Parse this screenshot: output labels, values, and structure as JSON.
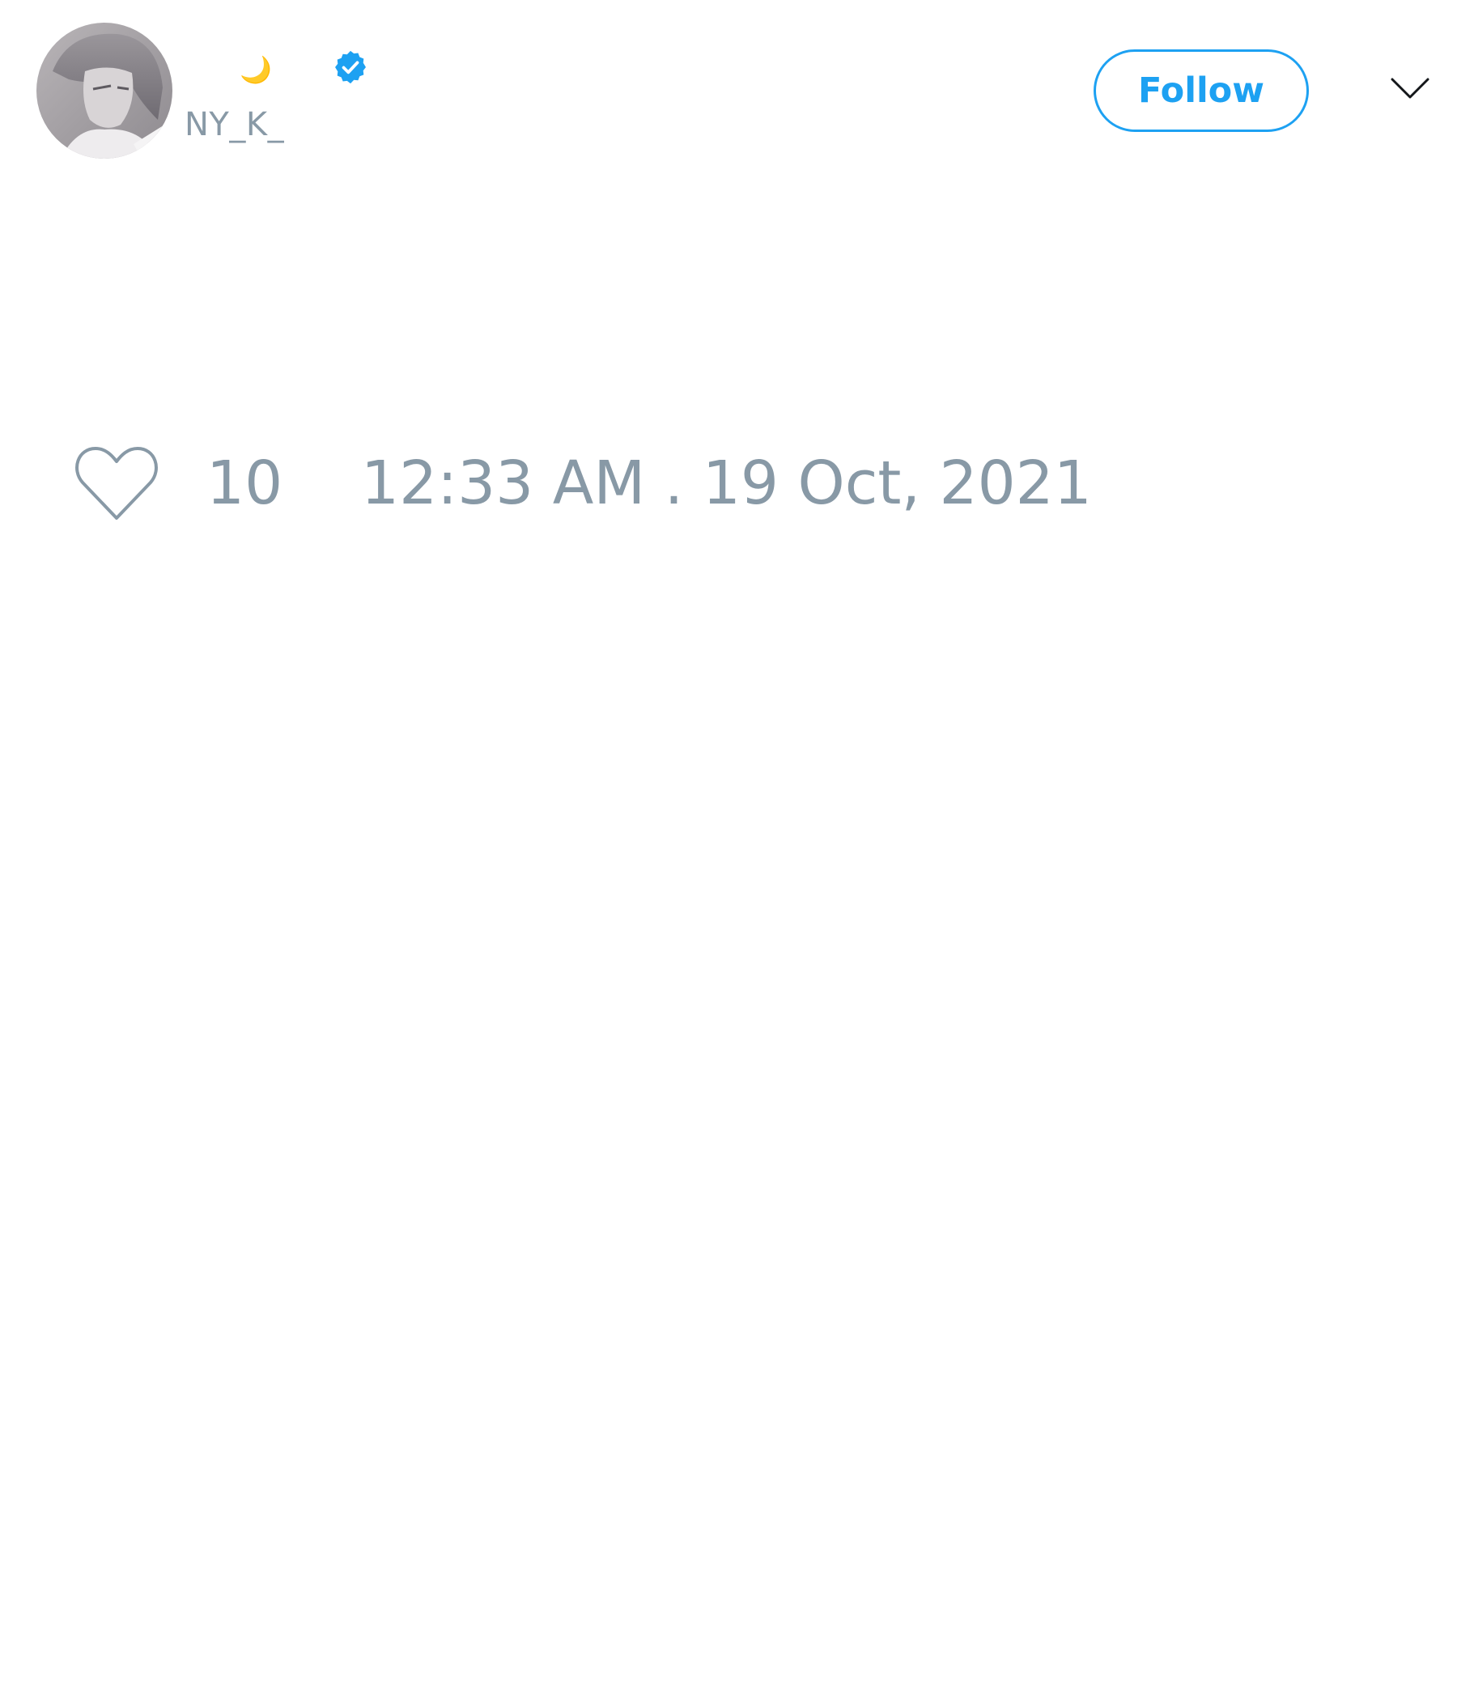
{
  "tweet": {
    "author": {
      "display_name": "🌙",
      "handle": "NY_K_",
      "verified": true,
      "avatar_icon": "avatar-image"
    },
    "follow_label": "Follow",
    "menu_icon": "chevron-down-icon",
    "likes": "10",
    "timestamp": "12:33 AM . 19 Oct, 2021"
  },
  "colors": {
    "accent": "#1da1f2",
    "muted_text": "#8899a6",
    "background": "#ffffff"
  }
}
